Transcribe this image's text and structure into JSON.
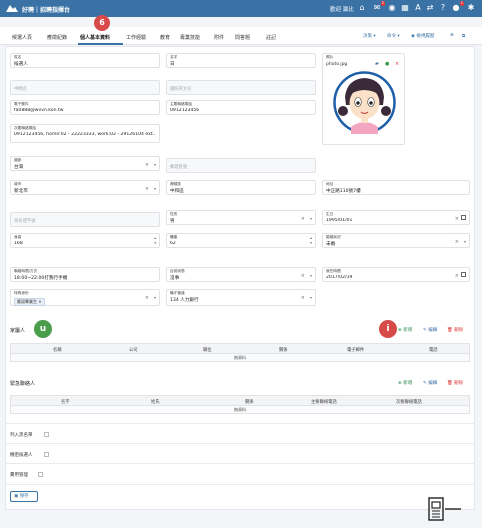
{
  "topbar": {
    "app_title": "好聘｜招聘指揮台",
    "welcome": "歡迎 瀛比",
    "notif_count": "2",
    "alert_count": "1"
  },
  "tabs": [
    {
      "label": "候選人頁"
    },
    {
      "label": "應徵紀錄"
    },
    {
      "label": "個人基本資料"
    },
    {
      "label": "工作經驗"
    },
    {
      "label": "教育"
    },
    {
      "label": "專業技能"
    },
    {
      "label": "附件"
    },
    {
      "label": "問答題"
    },
    {
      "label": "註記"
    }
  ],
  "step_marker": "6",
  "tab_tools": {
    "decide": "決策",
    "command": "命令",
    "history": "檢視履歷"
  },
  "form": {
    "name": {
      "label": "姓名",
      "value": "候選人"
    },
    "gender_name": {
      "label": "名字",
      "value": "日"
    },
    "middle_name": {
      "placeholder": "中間名"
    },
    "english_name": {
      "placeholder": "護照英文名"
    },
    "email": {
      "label": "電子郵件",
      "value": "fa0888@wvvn.kon.tw"
    },
    "phone": {
      "label": "主要聯絡電話",
      "value": "0912123456"
    },
    "other_phone": {
      "label": "次要聯絡電話",
      "value": "0912123456, home:02 - 22223333, work:02 - 29126104 ext..."
    },
    "photo": {
      "label": "照片",
      "filename": "photo.jpg"
    },
    "country": {
      "label": "國家",
      "value": "台灣"
    },
    "postal": {
      "placeholder": "郵遞區號"
    },
    "city": {
      "label": "城市",
      "value": "新北市"
    },
    "district": {
      "label": "鄉鎮區",
      "value": "中和區"
    },
    "address": {
      "label": "地址",
      "value": "中正路110號7樓"
    },
    "id_number": {
      "placeholder": "身份證字號"
    },
    "sex": {
      "label": "性別",
      "value": "男"
    },
    "birthday": {
      "label": "生日",
      "value": "1995/01/01"
    },
    "height": {
      "label": "身高",
      "value": "168"
    },
    "weight": {
      "label": "體重",
      "value": "62"
    },
    "marital": {
      "label": "婚姻狀況",
      "value": "未婚"
    },
    "contact_time": {
      "label": "聯絡時間/方式",
      "value": "18:00~22:00打我行手機"
    },
    "employment": {
      "label": "目前狀態",
      "value": "沒事"
    },
    "available": {
      "label": "就任時間",
      "value": "2017/02/19"
    },
    "special_identity": {
      "label": "特殊身份",
      "chip": "應屆畢業生"
    },
    "source": {
      "label": "職才管道",
      "value": "134 人力銀行"
    }
  },
  "markers": {
    "family": "u",
    "contacts": "i"
  },
  "family_section": {
    "title": "家屬人",
    "add": "新增",
    "edit": "編輯",
    "delete": "刪除",
    "columns": [
      "名稱",
      "公司",
      "職位",
      "關係",
      "電子郵件",
      "電話"
    ],
    "empty": "無資料"
  },
  "emergency_section": {
    "title": "緊急聯絡人",
    "add": "新增",
    "edit": "編輯",
    "delete": "刪除",
    "columns": [
      "名字",
      "姓氏",
      "關係",
      "主要聯絡電話",
      "次要聯絡電話"
    ],
    "empty": "無資料"
  },
  "checkboxes": [
    {
      "label": "列入黑名單"
    },
    {
      "label": "機密候選人"
    },
    {
      "label": "費用管理"
    }
  ],
  "save_label": "保存",
  "colors": {
    "brand": "#3a72a6",
    "danger": "#d84a4a",
    "success": "#4a9d4a"
  }
}
